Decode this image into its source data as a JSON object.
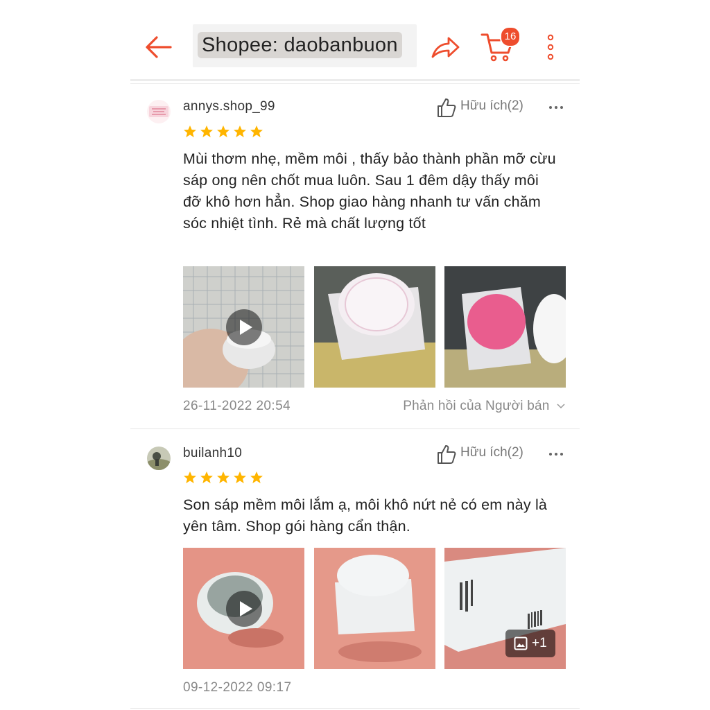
{
  "header": {
    "search_text": "Shopee: daobanbuon",
    "cart_count": "16"
  },
  "colors": {
    "accent": "#ee4d2d",
    "star": "#ffb500"
  },
  "reviews": [
    {
      "username": "annys.shop_99",
      "avatar_icon": "shop-logo-icon",
      "helpful_label": "Hữu ích(2)",
      "rating": 5,
      "comment": "Mùi thơm nhẹ, mềm môi , thấy bảo thành phần mỡ cừu sáp ong nên chốt mua luôn. Sau 1 đêm dậy thấy môi đỡ khô hơn hẳn. Shop giao hàng nhanh tư vấn chăm sóc nhiệt tình. Rẻ mà chất lượng tốt",
      "date": "26-11-2022 20:54",
      "reply_label": "Phản hồi của Người bán"
    },
    {
      "username": "builanh10",
      "avatar_icon": "user-avatar-icon",
      "helpful_label": "Hữu ích(2)",
      "rating": 5,
      "comment": "Son sáp mềm môi lắm ạ, môi khô nứt nẻ có em này là yên tâm. Shop gói hàng cẩn thận.",
      "date": "09-12-2022 09:17",
      "more_media": "+1"
    }
  ]
}
